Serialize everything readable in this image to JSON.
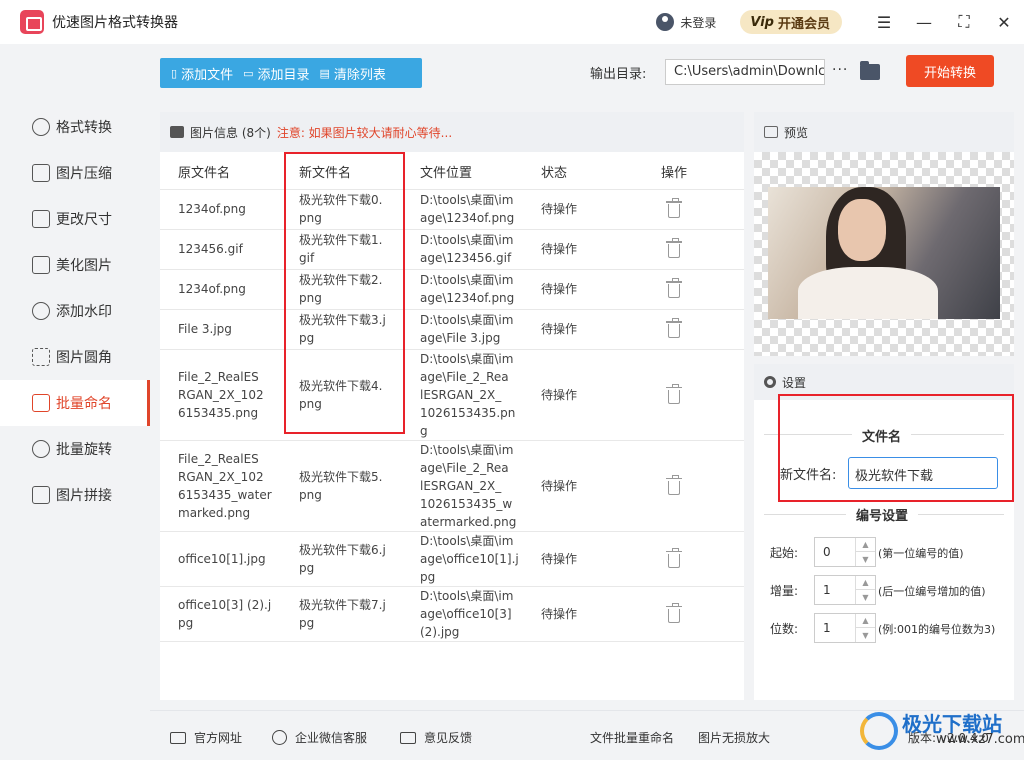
{
  "app": {
    "title": "优速图片格式转换器"
  },
  "titlebar": {
    "login": "未登录",
    "vip": "开通会员",
    "vip_icon": "Vip"
  },
  "sidebar": {
    "items": [
      {
        "label": "格式转换",
        "icon": "format-convert-icon"
      },
      {
        "label": "图片压缩",
        "icon": "compress-icon"
      },
      {
        "label": "更改尺寸",
        "icon": "resize-icon"
      },
      {
        "label": "美化图片",
        "icon": "beautify-icon"
      },
      {
        "label": "添加水印",
        "icon": "watermark-icon"
      },
      {
        "label": "图片圆角",
        "icon": "round-corner-icon"
      },
      {
        "label": "批量命名",
        "icon": "rename-icon",
        "active": true
      },
      {
        "label": "批量旋转",
        "icon": "rotate-icon"
      },
      {
        "label": "图片拼接",
        "icon": "stitch-icon"
      }
    ]
  },
  "toolbar": {
    "add_file": "添加文件",
    "add_dir": "添加目录",
    "clear_list": "清除列表",
    "output_label": "输出目录:",
    "output_path": "C:\\Users\\admin\\Downlc",
    "more": "···",
    "start": "开始转换"
  },
  "table": {
    "info_label": "图片信息 (8个)",
    "warning": "注意: 如果图片较大请耐心等待...",
    "headers": [
      "原文件名",
      "新文件名",
      "文件位置",
      "状态",
      "操作"
    ],
    "rows": [
      {
        "orig": [
          "1234of.png"
        ],
        "new": [
          "极光软件下载0.",
          "png"
        ],
        "loc": [
          "D:\\tools\\桌面\\im",
          "age\\1234of.png"
        ],
        "status": "待操作"
      },
      {
        "orig": [
          "123456.gif"
        ],
        "new": [
          "极光软件下载1.",
          "gif"
        ],
        "loc": [
          "D:\\tools\\桌面\\im",
          "age\\123456.gif"
        ],
        "status": "待操作"
      },
      {
        "orig": [
          "1234of.png"
        ],
        "new": [
          "极光软件下载2.",
          "png"
        ],
        "loc": [
          "D:\\tools\\桌面\\im",
          "age\\1234of.png"
        ],
        "status": "待操作"
      },
      {
        "orig": [
          "File 3.jpg"
        ],
        "new": [
          "极光软件下载3.j",
          "pg"
        ],
        "loc": [
          "D:\\tools\\桌面\\im",
          "age\\File 3.jpg"
        ],
        "status": "待操作"
      },
      {
        "orig": [
          "File_2_RealES",
          "RGAN_2X_102",
          "6153435.png"
        ],
        "new": [
          "极光软件下载4.",
          "png"
        ],
        "loc": [
          "D:\\tools\\桌面\\im",
          "age\\File_2_Rea",
          "lESRGAN_2X_",
          "1026153435.pn",
          "g"
        ],
        "status": "待操作"
      },
      {
        "orig": [
          "File_2_RealES",
          "RGAN_2X_102",
          "6153435_water",
          "marked.png"
        ],
        "new": [
          "极光软件下载5.",
          "png"
        ],
        "loc": [
          "D:\\tools\\桌面\\im",
          "age\\File_2_Rea",
          "lESRGAN_2X_",
          "1026153435_w",
          "atermarked.png"
        ],
        "status": "待操作"
      },
      {
        "orig": [
          "office10[1].jpg"
        ],
        "new": [
          "极光软件下载6.j",
          "pg"
        ],
        "loc": [
          "D:\\tools\\桌面\\im",
          "age\\office10[1].j",
          "pg"
        ],
        "status": "待操作"
      },
      {
        "orig": [
          "office10[3] (2).j",
          "pg"
        ],
        "new": [
          "极光软件下载7.j",
          "pg"
        ],
        "loc": [
          "D:\\tools\\桌面\\im",
          "age\\office10[3]",
          "(2).jpg"
        ],
        "status": "待操作"
      }
    ]
  },
  "preview": {
    "title": "预览"
  },
  "settings": {
    "title": "设置",
    "filename_section": "文件名",
    "filename_label": "新文件名:",
    "filename_value": "极光软件下载",
    "numbering_section": "编号设置",
    "start_label": "起始:",
    "start_value": "0",
    "start_hint": "(第一位编号的值)",
    "step_label": "增量:",
    "step_value": "1",
    "step_hint": "(后一位编号增加的值)",
    "digits_label": "位数:",
    "digits_value": "1",
    "digits_hint": "(例:001的编号位数为3)"
  },
  "footer": {
    "website": "官方网址",
    "wechat": "企业微信客服",
    "feedback": "意见反馈",
    "link1": "文件批量重命名",
    "link2": "图片无损放大",
    "version": "版本: v2.0.4.0"
  },
  "watermark": {
    "name": "极光下载站",
    "url": "www.xz7.com"
  },
  "colors": {
    "accent": "#ef4a24",
    "toolbar": "#3aa7e2",
    "highlight_box": "#e8222a",
    "active_nav": "#e0452a"
  }
}
